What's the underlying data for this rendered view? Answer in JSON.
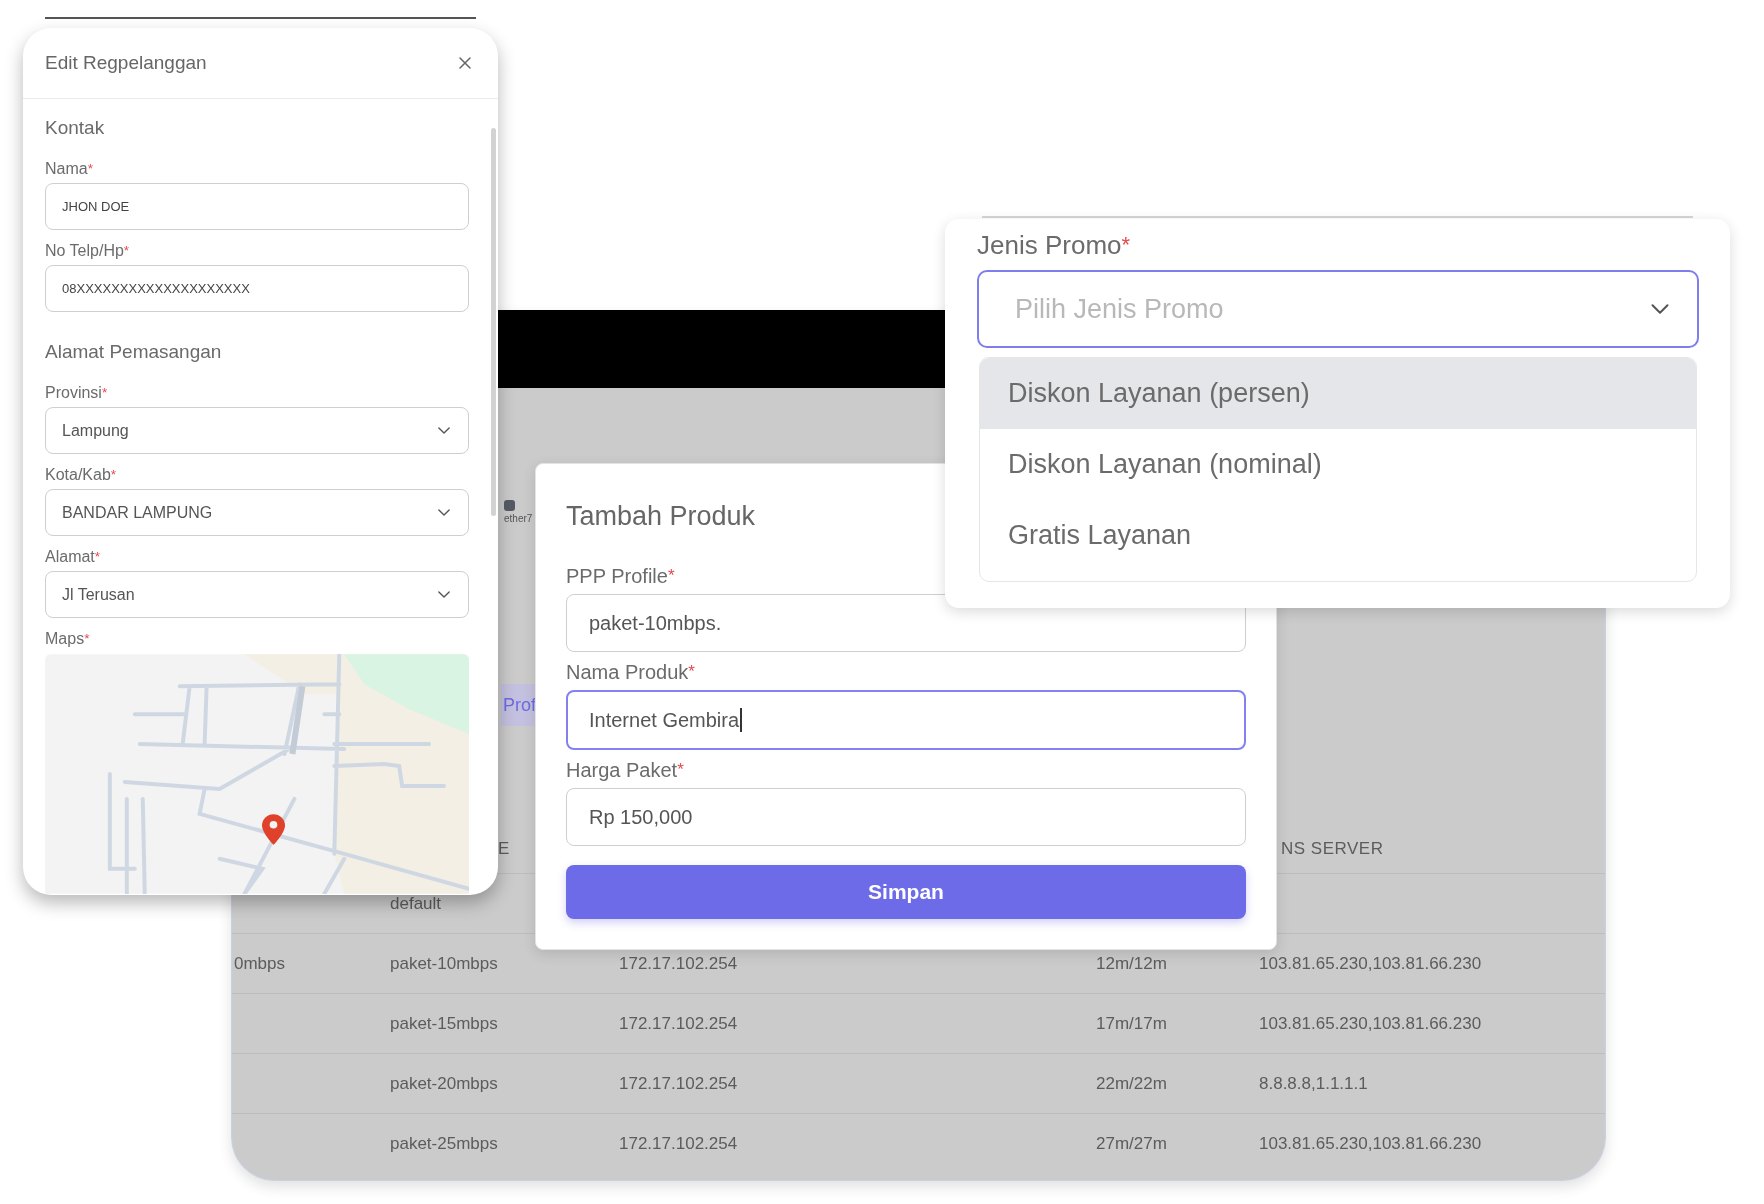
{
  "background_screen": {
    "port": {
      "label": "ether7"
    },
    "tabs": [
      {
        "label": "Prof",
        "selected": true
      }
    ],
    "table": {
      "header": {
        "column_2": "E",
        "column_5": "NS SERVER"
      },
      "rows": [
        {
          "column_2": "default"
        },
        {
          "column_1": "0mbps",
          "column_2": "paket-10mbps",
          "column_3": "172.17.102.254",
          "column_4": "12m/12m",
          "column_5": "103.81.65.230,103.81.66.230"
        },
        {
          "column_2": "paket-15mbps",
          "column_3": "172.17.102.254",
          "column_4": "17m/17m",
          "column_5": "103.81.65.230,103.81.66.230"
        },
        {
          "column_2": "paket-20mbps",
          "column_3": "172.17.102.254",
          "column_4": "22m/22m",
          "column_5": "8.8.8.8,1.1.1.1"
        },
        {
          "column_2": "paket-25mbps",
          "column_3": "172.17.102.254",
          "column_4": "27m/27m",
          "column_5": "103.81.65.230,103.81.66.230"
        }
      ]
    }
  },
  "edit_dialog": {
    "title": "Edit Regpelanggan",
    "sections": [
      {
        "heading": "Kontak",
        "fields": [
          {
            "label": "Nama",
            "required_mark": "*",
            "kind": "text",
            "value": "JHON DOE"
          },
          {
            "label": "No Telp/Hp",
            "required_mark": "*",
            "kind": "text",
            "value": "08XXXXXXXXXXXXXXXXXXXX"
          }
        ]
      },
      {
        "heading": "Alamat Pemasangan",
        "fields": [
          {
            "label": "Provinsi",
            "required_mark": "*",
            "kind": "select",
            "value": "Lampung"
          },
          {
            "label": "Kota/Kab",
            "required_mark": "*",
            "kind": "select",
            "value": "BANDAR LAMPUNG"
          },
          {
            "label": "Alamat",
            "required_mark": "*",
            "kind": "select",
            "value": "Jl Terusan"
          },
          {
            "label": "Maps",
            "required_mark": "*",
            "kind": "map"
          }
        ]
      }
    ]
  },
  "product_dialog": {
    "title": "Tambah Produk",
    "fields": [
      {
        "label": "PPP Profile",
        "required_mark": "*",
        "value": "paket-10mbps.",
        "focused": false
      },
      {
        "label": "Nama Produk",
        "required_mark": "*",
        "value": "Internet Gembira",
        "focused": true
      },
      {
        "label": "Harga Paket",
        "required_mark": "*",
        "value": "Rp 150,000",
        "focused": false
      }
    ],
    "button": "Simpan"
  },
  "promo_panel": {
    "label": "Jenis Promo",
    "required_mark": "*",
    "placeholder": "Pilih Jenis Promo",
    "options": [
      {
        "label": "Diskon Layanan (persen)",
        "highlighted": true
      },
      {
        "label": "Diskon Layanan (nominal)",
        "highlighted": false
      },
      {
        "label": "Gratis Layanan",
        "highlighted": false
      }
    ]
  }
}
